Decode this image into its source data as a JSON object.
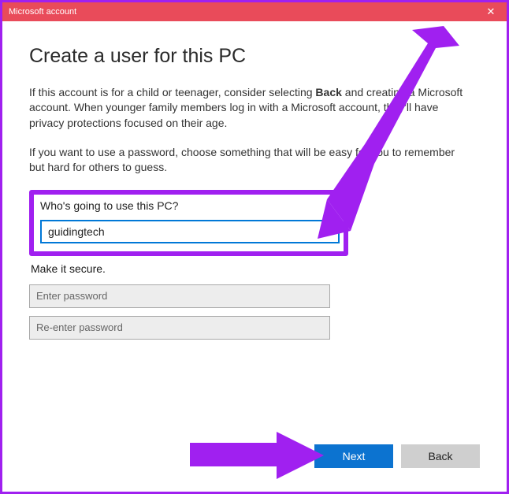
{
  "window": {
    "title": "Microsoft account",
    "close_label": "✕"
  },
  "heading": "Create a user for this PC",
  "intro_part1": "If this account is for a child or teenager, consider selecting ",
  "intro_bold": "Back",
  "intro_part2": " and creating a Microsoft account. When younger family members log in with a Microsoft account, they'll have privacy protections focused on their age.",
  "password_hint": "If you want to use a password, choose something that will be easy for you to remember but hard for others to guess.",
  "who_label": "Who's going to use this PC?",
  "username_value": "guidingtech",
  "clear_label": "✕",
  "secure_label": "Make it secure.",
  "password_placeholder": "Enter password",
  "repassword_placeholder": "Re-enter password",
  "buttons": {
    "next": "Next",
    "back": "Back"
  }
}
